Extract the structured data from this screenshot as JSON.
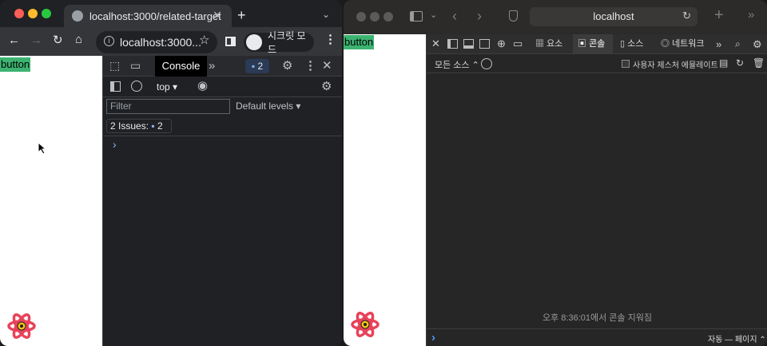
{
  "chrome": {
    "tab_title": "localhost:3000/related-target",
    "url": "localhost:3000...",
    "incognito_label": "시크릿 모드",
    "page_button": "button",
    "devtools": {
      "console_tab": "Console",
      "issues_badge_count": "2",
      "context": "top",
      "filter_placeholder": "Filter",
      "levels": "Default levels",
      "issues_label": "2 Issues:",
      "issues_count": "2",
      "prompt": "›"
    }
  },
  "safari": {
    "url": "localhost",
    "page_button": "button",
    "devtools": {
      "tab_elements": "요소",
      "tab_console": "콘솔",
      "tab_sources": "소스",
      "tab_network": "네트워크",
      "all_sources": "모든 소스",
      "emulate_user_gesture": "사용자 제스처 에뮬레이트",
      "cleared_message": "오후 8:36:01에서 콘솔 지워짐",
      "auto_page": "자동 — 페이지",
      "prompt": "›"
    }
  },
  "colors": {
    "button_bg": "#3cb371",
    "react_logo": "#e8425a"
  },
  "icons": [
    "globe-icon",
    "back-icon",
    "forward-icon",
    "reload-icon",
    "home-icon",
    "info-icon",
    "star-icon",
    "sidepanel-icon",
    "incognito-icon",
    "menu-icon",
    "inspect-icon",
    "device-icon",
    "settings-icon",
    "close-icon",
    "sidebar-icon",
    "clear-icon",
    "eye-icon",
    "chat-icon",
    "chevron-down-icon",
    "react-logo-icon"
  ]
}
